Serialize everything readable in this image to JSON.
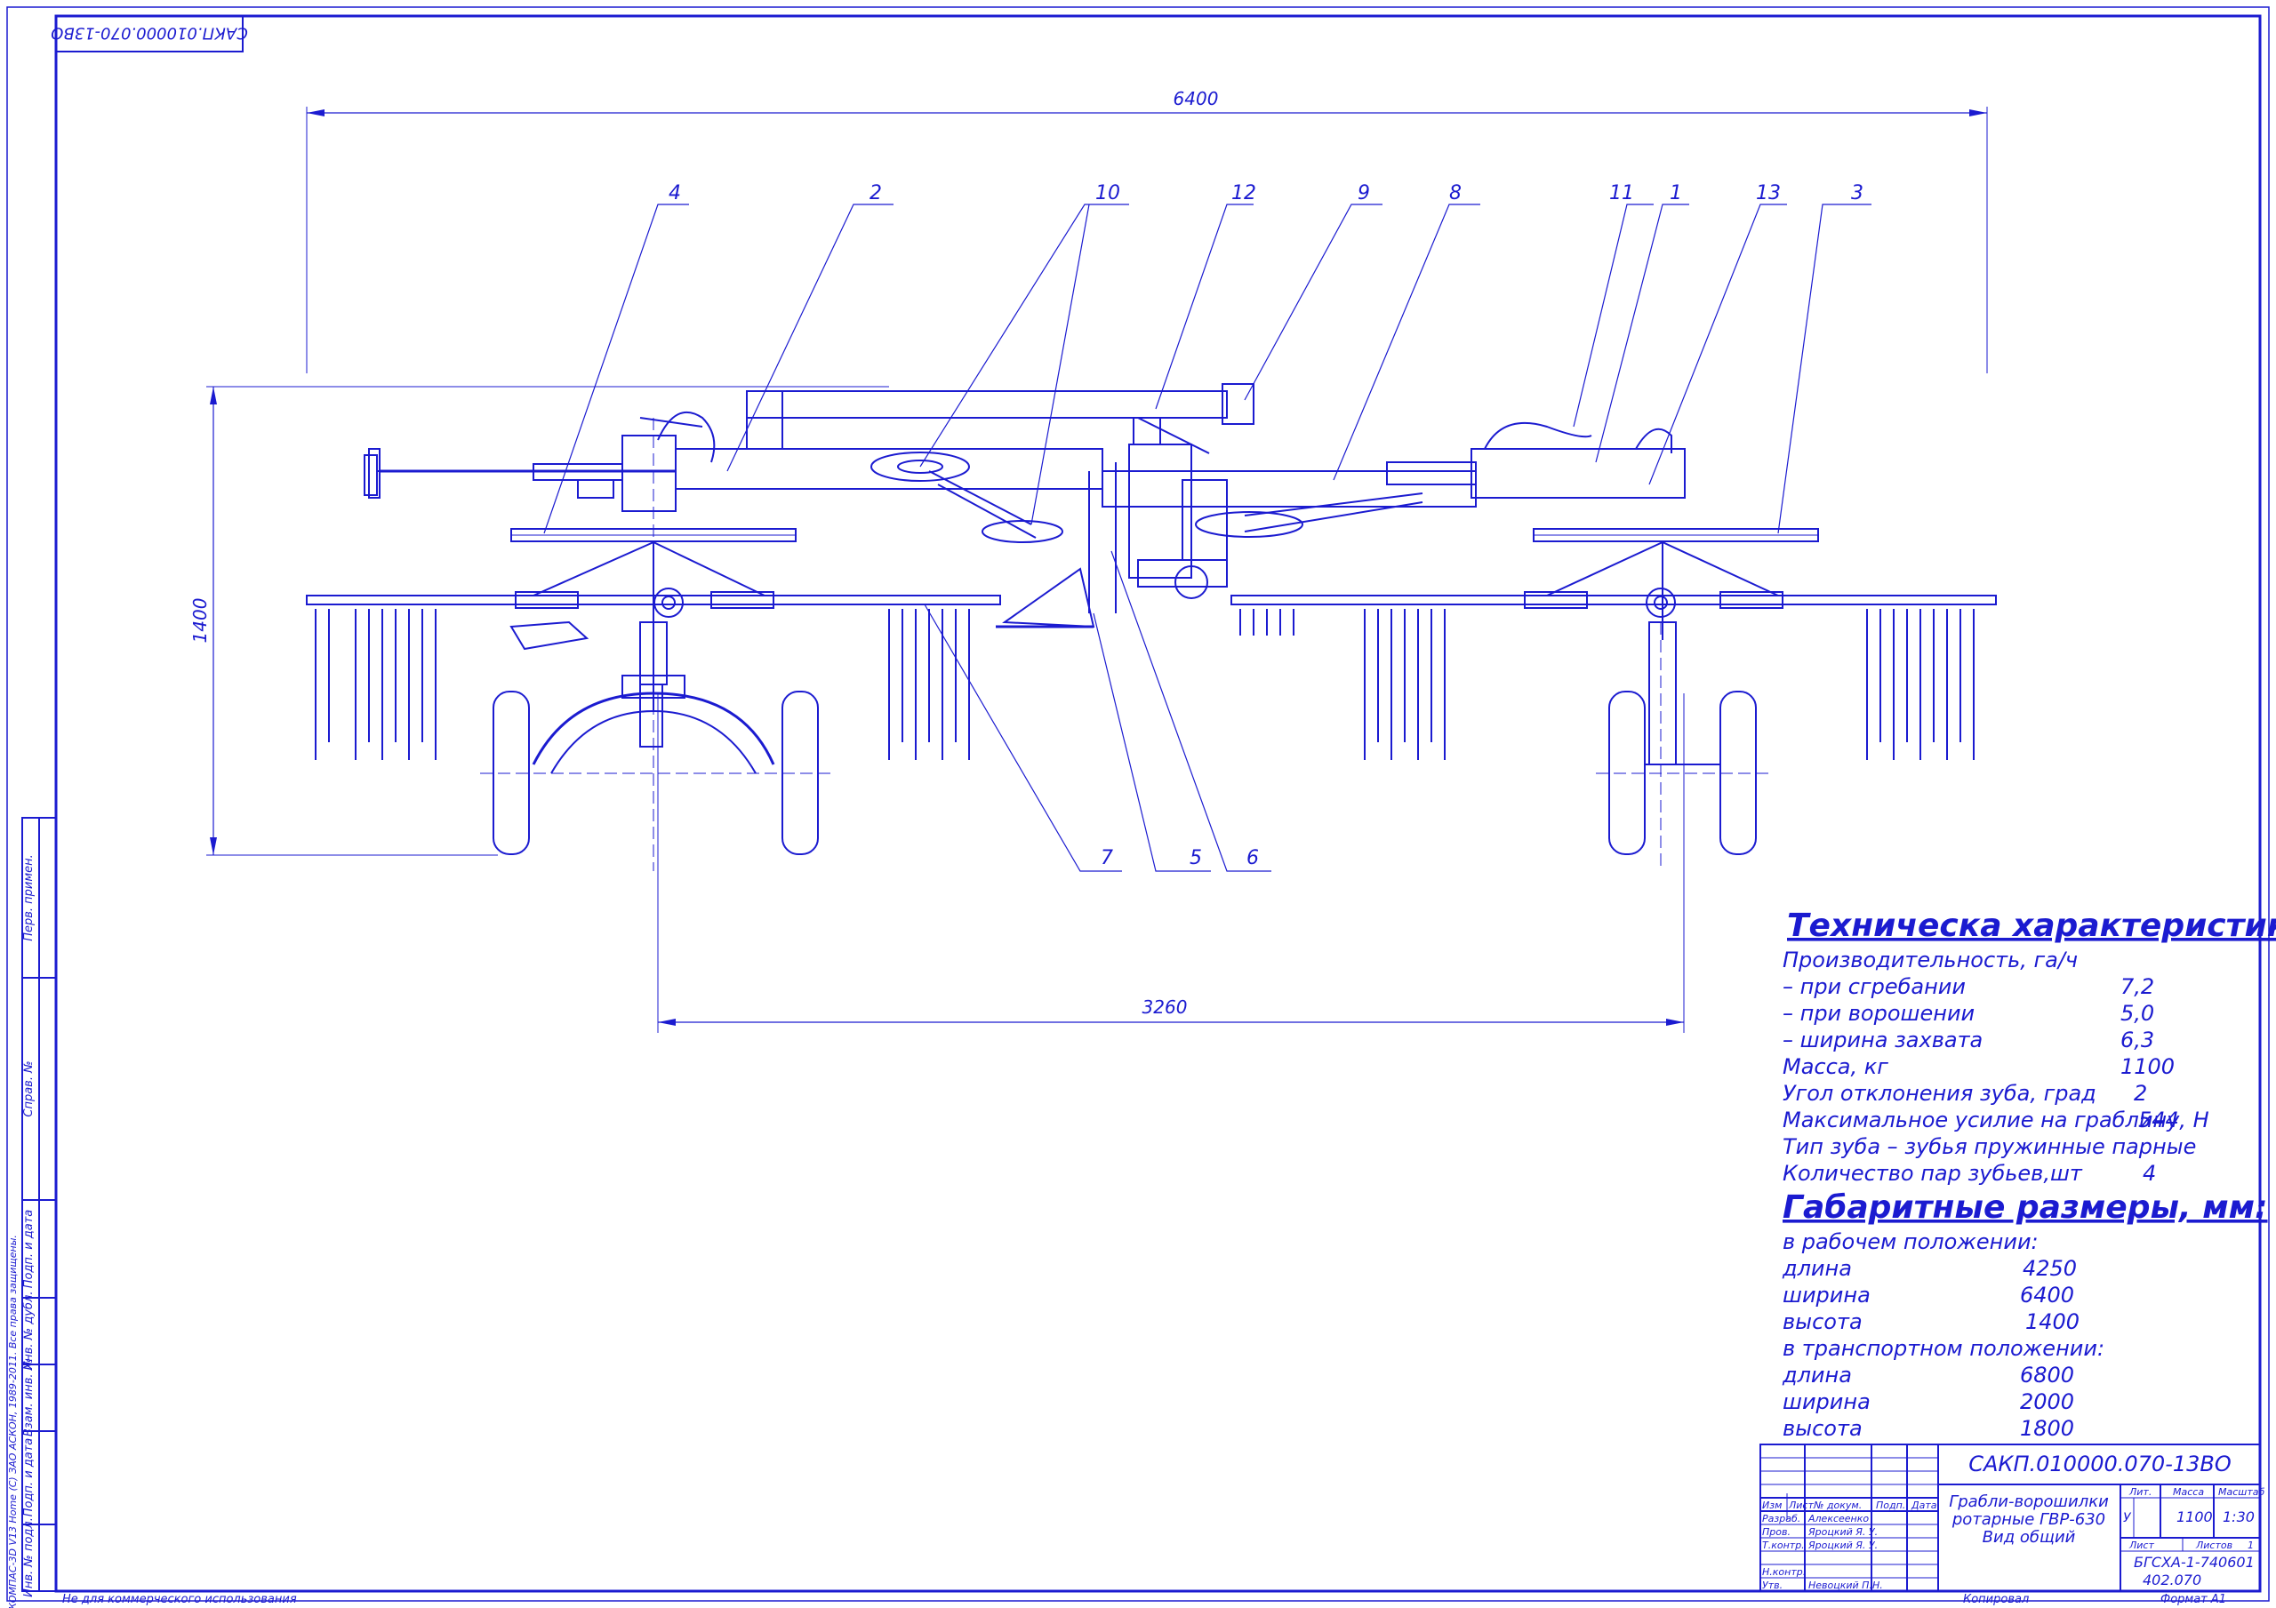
{
  "drawing": {
    "rotated_stamp": "САКП.010000.070-13ВО",
    "dimensions": {
      "overall_width": "6400",
      "height": "1400",
      "track": "3260"
    },
    "callouts": [
      "1",
      "2",
      "3",
      "4",
      "5",
      "6",
      "7",
      "8",
      "9",
      "10",
      "11",
      "12",
      "13"
    ]
  },
  "specs": {
    "title": "Техническа характеристика:",
    "lines": [
      {
        "label": "Производительность, га/ч",
        "value": ""
      },
      {
        "label": "–    при сгребании",
        "value": "7,2"
      },
      {
        "label": "–    при ворошении",
        "value": "5,0"
      },
      {
        "label": "–    ширина захвата",
        "value": "6,3"
      },
      {
        "label": "Масса, кг",
        "value": "1100"
      },
      {
        "label": "Угол отклонения зуба, град",
        "value": "2"
      },
      {
        "label": "Максимальное усилие на граблину, Н",
        "value": "544"
      },
      {
        "label": "Тип зуба – зубья пружинные парные",
        "value": ""
      },
      {
        "label": "Количество пар зубьев,шт",
        "value": "4"
      }
    ]
  },
  "dims": {
    "title": "Габаритные размеры, мм:",
    "work_header": "в рабочем положении:",
    "work": [
      {
        "label": "длина",
        "value": "4250"
      },
      {
        "label": "ширина",
        "value": "6400"
      },
      {
        "label": "высота",
        "value": "1400"
      }
    ],
    "transport_header": "в транспортном положении:",
    "transport": [
      {
        "label": "длина",
        "value": "6800"
      },
      {
        "label": "ширина",
        "value": "2000"
      },
      {
        "label": "высота",
        "value": "1800"
      }
    ]
  },
  "titleblock": {
    "doc_code": "САКП.010000.070-13ВО",
    "name_line1": "Грабли-ворошилки",
    "name_line2": "ротарные ГВР-630",
    "name_line3": "Вид общий",
    "hdr_izm": "Изм",
    "hdr_list": "Лист",
    "hdr_ndoc": "№ докум.",
    "hdr_podp": "Подп.",
    "hdr_data": "Дата",
    "r1_role": "Разраб.",
    "r1_name": "Алексеенко",
    "r2_role": "Пров.",
    "r2_name": "Яроцкий Я. У.",
    "r3_role": "Т.контр.",
    "r3_name": "Яроцкий Я. У.",
    "r4_role": "Н.контр.",
    "r4_name": "",
    "r5_role": "Утв.",
    "r5_name": "Невоцкий П.Н.",
    "lit_hdr": "Лит.",
    "mass_hdr": "Масса",
    "scale_hdr": "Масштаб",
    "lit": "У",
    "mass": "1100",
    "scale": "1:30",
    "sheet_hdr": "Лист",
    "sheets_hdr": "Листов",
    "sheets": "1",
    "org_line1": "БГСХА-1-740601",
    "org_line2": "402.070"
  },
  "side_column": {
    "perv_primen": "Перв. примен.",
    "sprav": "Справ. №",
    "podp_data": "Подп. и дата",
    "inv_dubl": "Инв. № дубл.",
    "vzam_inv": "Взам. инв. №",
    "podp_data2": "Подп. и дата",
    "inv_podl": "Инв. № подл.",
    "kompas": "КОМПАС-3D V13 Home (С) ЗАО АСКОН, 1989-2011. Все права защищены."
  },
  "footer": {
    "noncommercial": "Не для коммерческого использования",
    "copied": "Копировал",
    "format": "Формат   А1"
  }
}
